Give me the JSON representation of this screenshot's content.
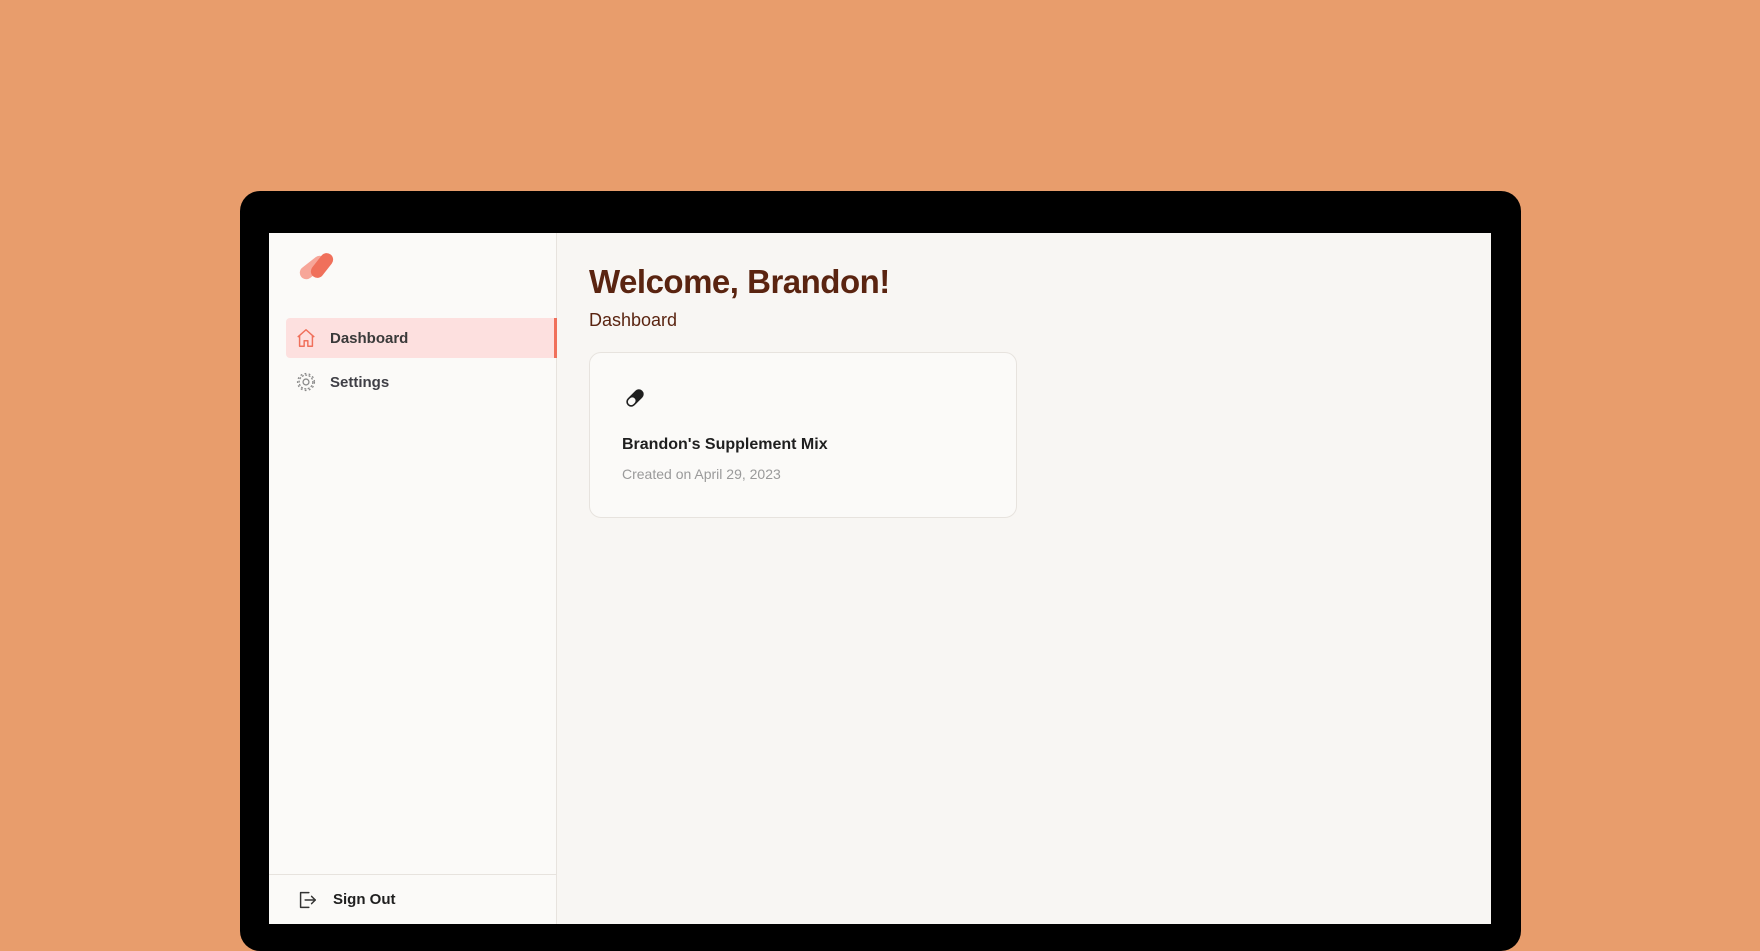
{
  "colors": {
    "background": "#E89D6C",
    "accent": "#F0705B",
    "active_nav_bg": "#FDE0DF",
    "heading": "#5A2410"
  },
  "sidebar": {
    "logo_icon": "pill-logo-icon",
    "items": [
      {
        "label": "Dashboard",
        "icon": "home-icon",
        "active": true
      },
      {
        "label": "Settings",
        "icon": "gear-icon",
        "active": false
      }
    ],
    "sign_out": {
      "label": "Sign Out",
      "icon": "sign-out-icon"
    }
  },
  "main": {
    "welcome": "Welcome, Brandon!",
    "subtitle": "Dashboard",
    "cards": [
      {
        "icon": "pill-icon",
        "title": "Brandon's Supplement Mix",
        "date": "Created on April 29, 2023"
      }
    ]
  }
}
